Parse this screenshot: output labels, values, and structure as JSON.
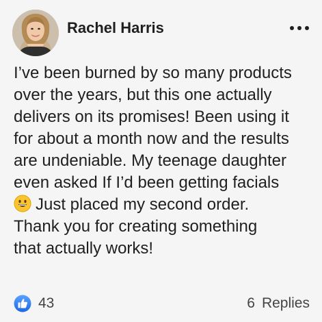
{
  "comment": {
    "author": "Rachel Harris",
    "body_lines": [
      "I’ve been burned by so many products",
      "over the years, but this one actually",
      "delivers on its promises! Been using it",
      "for about a month now and the results",
      "are undeniable. My teenage daughter",
      "even asked If I’d been getting facials",
      "Just placed my second order.",
      "Thank you for creating something",
      "that actually works!"
    ],
    "emoji": "grinning-face-emoji",
    "like_count": "43",
    "replies_count": "6",
    "replies_label": "Replies"
  },
  "colors": {
    "background": "#f5f5f6",
    "text": "#1f1f1f",
    "like_blue": "#3b82f6"
  },
  "icons": {
    "more": "more-options-icon",
    "like": "thumbs-up-icon"
  }
}
